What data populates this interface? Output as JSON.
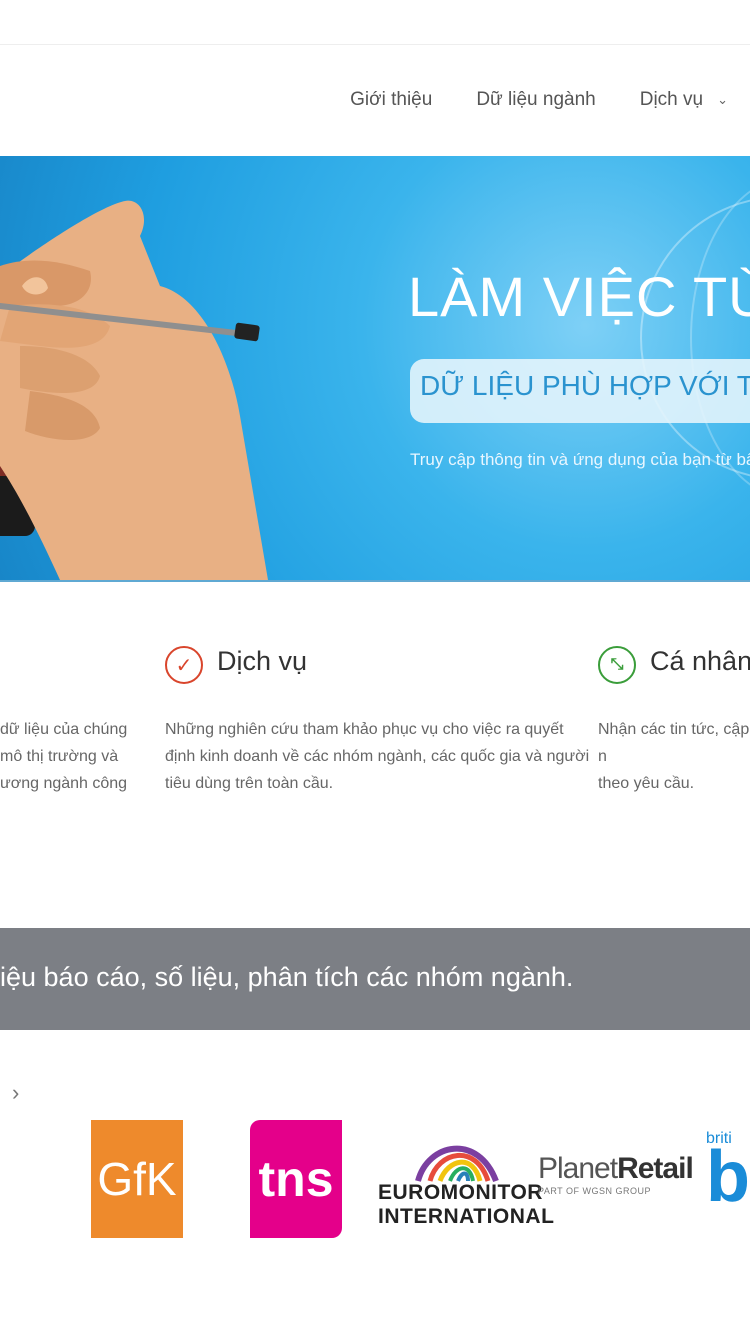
{
  "nav": {
    "items": [
      {
        "label": "Giới thiệu"
      },
      {
        "label": "Dữ liệu ngành"
      },
      {
        "label": "Dịch vụ",
        "has_dropdown": true
      }
    ]
  },
  "hero": {
    "title": "LÀM VIỆC TỪ BA",
    "subtitle": "DỮ LIỆU PHÙ HỢP VỚI THIẾT",
    "note": "Truy cập thông tin và ứng dụng của bạn từ bất c"
  },
  "features": [
    {
      "desc_lines": [
        "dữ liệu của chúng",
        "mô thị trường và",
        "ương ngành công"
      ]
    },
    {
      "title": "Dịch vụ",
      "icon": "check-circle-icon",
      "icon_color": "#d9452c",
      "desc_lines": [
        "Những nghiên cứu tham khảo phục vụ cho việc ra quyết",
        "định kinh doanh về các nhóm ngành, các quốc gia và người",
        "tiêu dùng trên toàn cầu."
      ]
    },
    {
      "title": "Cá nhân h",
      "icon": "arrows-in-icon",
      "icon_color": "#3a9d3a",
      "desc_lines": [
        "Nhận các tin tức, cập n",
        "theo yêu cầu."
      ]
    }
  ],
  "banner": {
    "text": "iệu báo cáo, số liệu, phân tích các nhóm ngành."
  },
  "partners": {
    "next_arrow": "›",
    "gfk": "GfK",
    "tns": "tns",
    "euromonitor": [
      "EUROMONITOR",
      "INTERNATIONAL"
    ],
    "planet_retail": {
      "name_light": "Planet",
      "name_bold": "Retail",
      "sub": "PART OF WGSN GROUP"
    },
    "british": {
      "small": "briti",
      "big": "b"
    }
  },
  "colors": {
    "hero_blue": "#2aa6e6",
    "banner_gray": "#7c7f85",
    "gfk_orange": "#ee8a2c",
    "tns_pink": "#e4008a"
  }
}
